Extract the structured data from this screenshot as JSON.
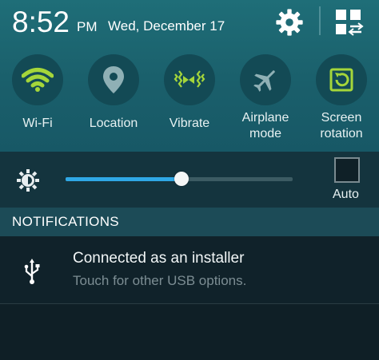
{
  "status": {
    "time": "8:52",
    "ampm": "PM",
    "date": "Wed, December 17",
    "settings_icon": "gear-icon",
    "grid_icon": "quick-panel-edit-icon"
  },
  "quick_settings": [
    {
      "label": "Wi-Fi",
      "icon": "wifi-icon",
      "active": true
    },
    {
      "label": "Location",
      "icon": "location-pin-icon",
      "active": false
    },
    {
      "label": "Vibrate",
      "icon": "vibrate-icon",
      "active": true
    },
    {
      "label": "Airplane",
      "label2": "mode",
      "icon": "airplane-icon",
      "active": false
    },
    {
      "label": "Screen",
      "label2": "rotation",
      "icon": "screen-rotation-icon",
      "active": true
    }
  ],
  "brightness": {
    "level": 0.51,
    "auto_label": "Auto",
    "auto_checked": false
  },
  "notifications": {
    "header": "NOTIFICATIONS",
    "items": [
      {
        "title": "Connected as an installer",
        "subtitle": "Touch for other USB options.",
        "icon": "usb-icon"
      }
    ]
  },
  "colors": {
    "active": "#a5d63a",
    "inactive": "#8fb0b5",
    "slider": "#2fa8e6"
  }
}
